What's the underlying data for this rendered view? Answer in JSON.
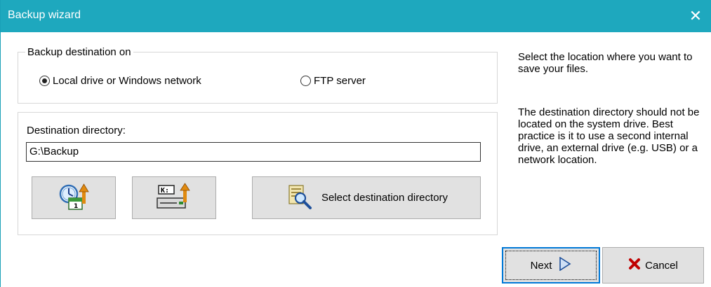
{
  "window": {
    "title": "Backup wizard",
    "close_glyph": "✕"
  },
  "destination_group": {
    "legend": "Backup destination on",
    "options": [
      {
        "label": "Local drive or Windows network",
        "selected": true
      },
      {
        "label": "FTP server",
        "selected": false
      }
    ]
  },
  "directory_group": {
    "label": "Destination directory:",
    "value": "G:\\Backup",
    "icon_button_1": "clock-calendar-upload-icon",
    "icon_button_2": "drive-k-upload-icon",
    "icon_button_2_text": "K:",
    "select_button_label": "Select destination directory",
    "select_button_icon": "folder-search-icon"
  },
  "help": {
    "paragraph1": "Select the location where you want to save your files.",
    "paragraph2": "The destination directory should not be located on the system drive. Best practice is it to use a second internal drive, an external drive (e.g. USB) or a network location."
  },
  "footer": {
    "next_label": "Next",
    "cancel_label": "Cancel"
  },
  "colors": {
    "titlebar": "#1ea8be",
    "button_face": "#e1e1e1",
    "default_border": "#0078d7"
  }
}
